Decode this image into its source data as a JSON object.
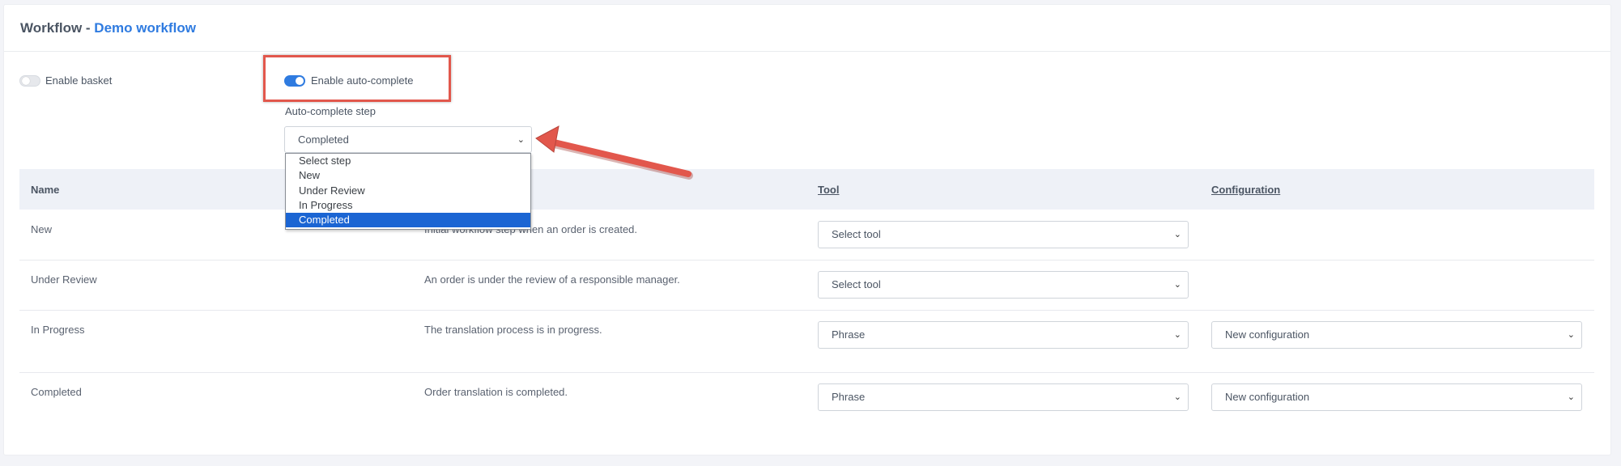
{
  "header": {
    "title_prefix": "Workflow - ",
    "title_name": "Demo workflow"
  },
  "settings": {
    "enable_basket_label": "Enable basket",
    "enable_basket_on": false,
    "enable_autocomplete_label": "Enable auto-complete",
    "enable_autocomplete_on": true,
    "autocomplete_step_label": "Auto-complete step",
    "autocomplete_step_value": "Completed",
    "autocomplete_options": [
      "Select step",
      "New",
      "Under Review",
      "In Progress",
      "Completed"
    ]
  },
  "table": {
    "headers": {
      "name": "Name",
      "tool": "Tool",
      "configuration": "Configuration"
    },
    "rows": [
      {
        "name": "New",
        "description": "Initial workflow step when an order is created.",
        "tool": "Select tool",
        "configuration": ""
      },
      {
        "name": "Under Review",
        "description": "An order is under the review of a responsible manager.",
        "tool": "Select tool",
        "configuration": ""
      },
      {
        "name": "In Progress",
        "description": "The translation process is in progress.",
        "tool": "Phrase",
        "configuration": "New configuration"
      },
      {
        "name": "Completed",
        "description": "Order translation is completed.",
        "tool": "Phrase",
        "configuration": "New configuration"
      }
    ]
  },
  "colors": {
    "accent": "#2f7be0",
    "annotation": "#e2574c",
    "selected": "#1b65d3"
  }
}
